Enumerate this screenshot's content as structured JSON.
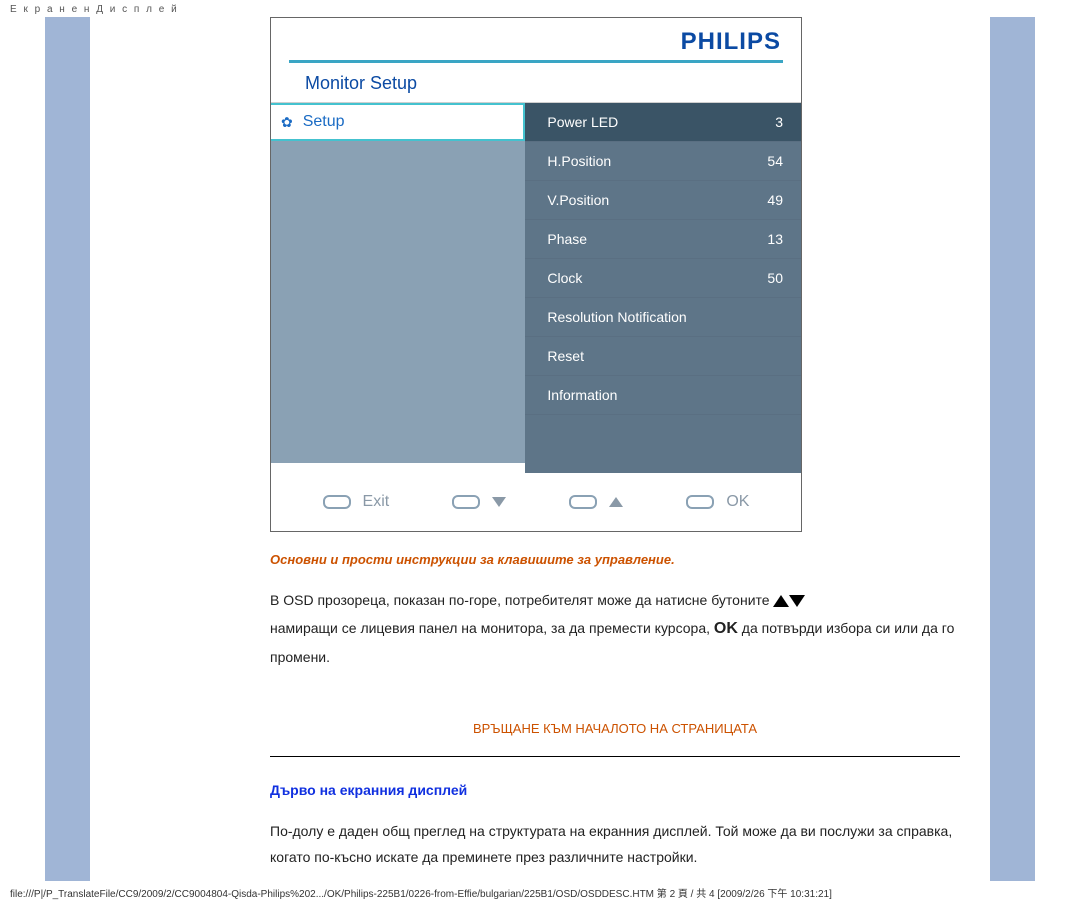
{
  "header_top": "Е к р а н е н Д и с п л е й",
  "osd": {
    "brand": "PHILIPS",
    "title": "Monitor Setup",
    "left_item": "Setup",
    "rows": [
      {
        "label": "Power LED",
        "value": "3"
      },
      {
        "label": "H.Position",
        "value": "54"
      },
      {
        "label": "V.Position",
        "value": "49"
      },
      {
        "label": "Phase",
        "value": "13"
      },
      {
        "label": "Clock",
        "value": "50"
      },
      {
        "label": "Resolution Notification",
        "value": ""
      },
      {
        "label": "Reset",
        "value": ""
      },
      {
        "label": "Information",
        "value": ""
      }
    ],
    "btn_exit": "Exit",
    "btn_ok": "OK"
  },
  "text": {
    "red_heading": "Основни и прости инструкции за клавишите за управление.",
    "p1a": "В OSD прозореца, показан по-горе, потребителят може да натисне бутоните ",
    "p1b": "намиращи се лицевия панел на монитора, за да премести курсора, ",
    "p1c": " да потвърди избора си или да го промени.",
    "ok_inline": "OK",
    "back_top": "ВРЪЩАНЕ КЪМ НАЧАЛОТО НА СТРАНИЦАТА",
    "blue_h": "Дърво на екранния дисплей",
    "p2": "По-долу е даден общ преглед на структурата на екранния дисплей. Той може да ви послужи за справка, когато по-късно искате да преминете през различните настройки."
  },
  "footer": "file:///P|/P_TranslateFile/CC9/2009/2/CC9004804-Qisda-Philips%202.../OK/Philips-225B1/0226-from-Effie/bulgarian/225B1/OSD/OSDDESC.HTM 第 2 頁 / 共 4  [2009/2/26 下午 10:31:21]"
}
